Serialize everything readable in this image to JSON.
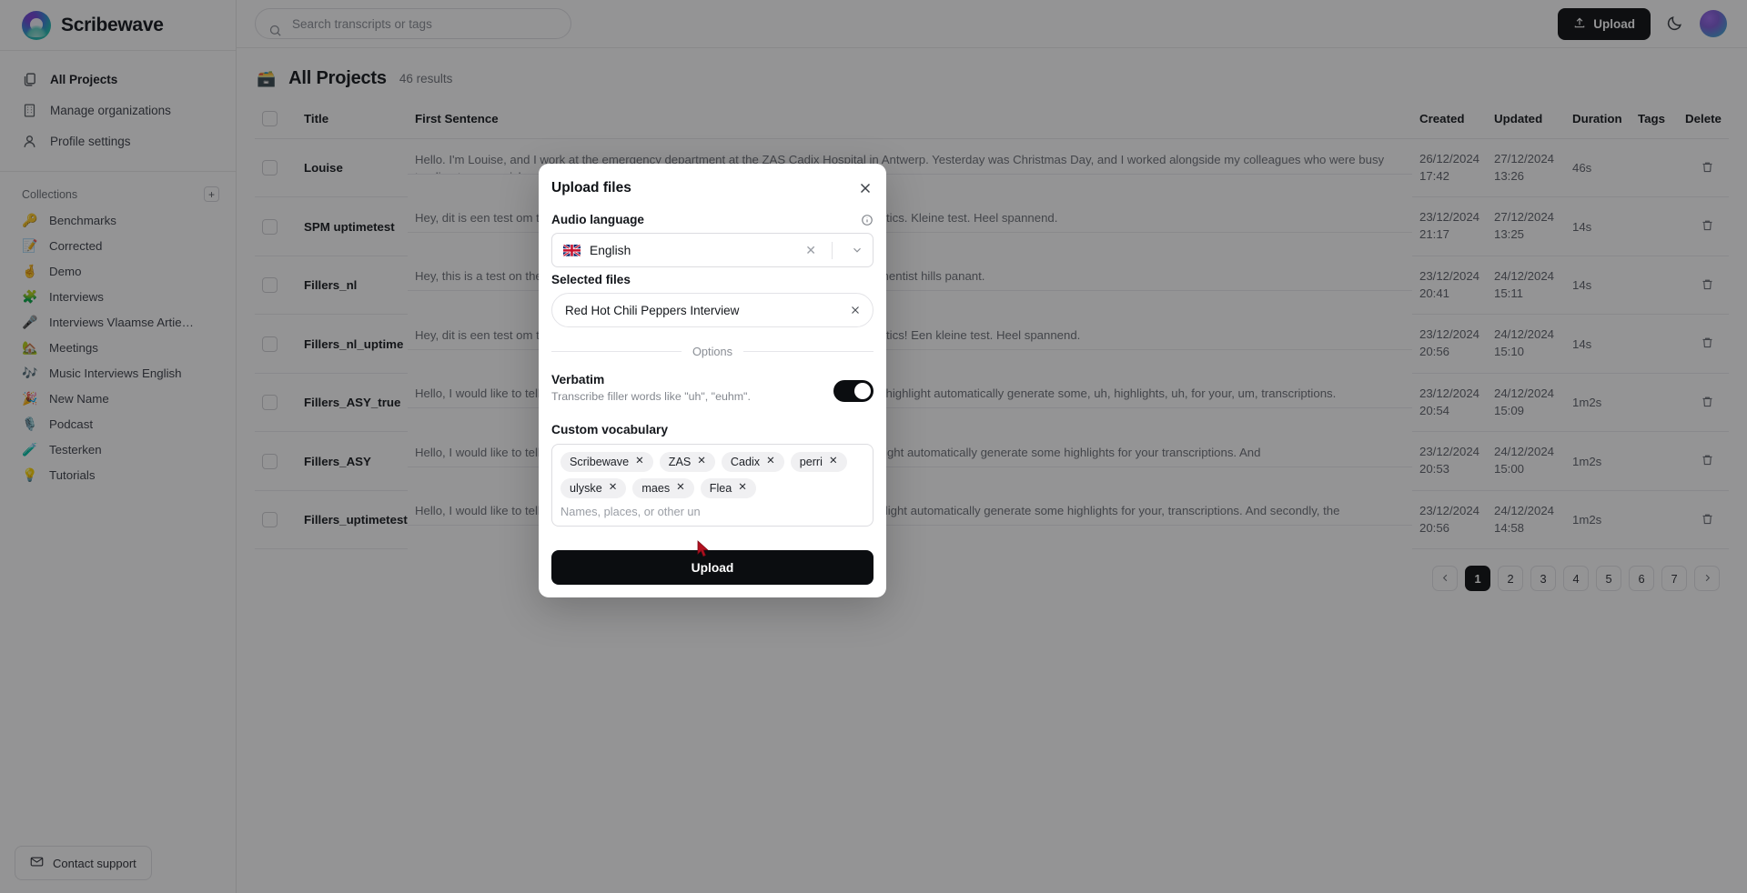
{
  "brand": {
    "name": "Scribewave",
    "logo_icon": "scribewave-logo"
  },
  "sidebar": {
    "nav": [
      {
        "label": "All Projects",
        "icon": "documents-icon"
      },
      {
        "label": "Manage organizations",
        "icon": "building-icon"
      },
      {
        "label": "Profile settings",
        "icon": "user-icon"
      }
    ],
    "collections_title": "Collections",
    "add_icon": "plus-icon",
    "collections": [
      {
        "emoji": "🔑",
        "label": "Benchmarks"
      },
      {
        "emoji": "📝",
        "label": "Corrected"
      },
      {
        "emoji": "🤞",
        "label": "Demo"
      },
      {
        "emoji": "🧩",
        "label": "Interviews"
      },
      {
        "emoji": "🎤",
        "label": "Interviews Vlaamse Artiesten"
      },
      {
        "emoji": "🏡",
        "label": "Meetings"
      },
      {
        "emoji": "🎶",
        "label": "Music Interviews English"
      },
      {
        "emoji": "🎉",
        "label": "New Name"
      },
      {
        "emoji": "🎙️",
        "label": "Podcast"
      },
      {
        "emoji": "🧪",
        "label": "Testerken"
      },
      {
        "emoji": "💡",
        "label": "Tutorials"
      }
    ],
    "support_label": "Contact support",
    "support_icon": "mail-icon"
  },
  "topbar": {
    "search_placeholder": "Search transcripts or tags",
    "search_value": "",
    "search_icon": "search-icon",
    "upload_label": "Upload",
    "upload_icon": "upload-icon",
    "theme_icon": "moon-icon",
    "avatar_icon": "avatar"
  },
  "page": {
    "emoji": "🗃️",
    "title": "All Projects",
    "results": "46 results"
  },
  "table": {
    "headers": [
      "Title",
      "First Sentence",
      "Created",
      "Updated",
      "Duration",
      "Tags",
      "Delete"
    ],
    "rows": [
      {
        "title": "Louise",
        "sentence": "Hello. I'm Louise, and I work at the emergency department at the ZAS Cadix Hospital in Antwerp. Yesterday was Christmas Day, and I worked alongside my colleagues who were busy tending to many sick patients. It was hectic, so we arranged a little walking",
        "created": "26/12/2024 17:42",
        "updated": "27/12/2024 13:26",
        "duration": "46s"
      },
      {
        "title": "SPM uptimetest",
        "sentence": "Hey, dit is een test om te kijken of alles nog steeds goed gefilterd worden met Speechmatics. Kleine test. Heel spannend.",
        "created": "23/12/2024 21:17",
        "updated": "27/12/2024 13:25",
        "duration": "14s"
      },
      {
        "title": "Fillers_nl",
        "sentence": "Hey, this is a test on the get some fillers in there to see what were the speechmatics clementist hills panant.",
        "created": "23/12/2024 20:41",
        "updated": "24/12/2024 15:11",
        "duration": "14s"
      },
      {
        "title": "Fillers_nl_uptime",
        "sentence": "Hey, dit is een test om te kijken of alles nog steeds goed gefilterd worden met Speechmatics! Een kleine test. Heel spannend.",
        "created": "23/12/2024 20:56",
        "updated": "24/12/2024 15:10",
        "duration": "14s"
      },
      {
        "title": "Fillers_ASY_true",
        "sentence": "Hello, I would like to tell you about Scribewave, um, a very nice, tool which allows you to highlight automatically generate some, uh, highlights, uh, for your, um, transcriptions.",
        "created": "23/12/2024 20:54",
        "updated": "24/12/2024 15:09",
        "duration": "1m2s"
      },
      {
        "title": "Fillers_ASY",
        "sentence": "Hello, I would like to tell you about Scribewave, a very nice tool which allows you to highlight automatically generate some highlights for your transcriptions. And",
        "created": "23/12/2024 20:53",
        "updated": "24/12/2024 15:00",
        "duration": "1m2s"
      },
      {
        "title": "Fillers_uptimetest",
        "sentence": "Hello, I would like to tell you about Scribewave, a very nice, tool which allows you to highlight automatically generate some highlights for your, transcriptions. And secondly, the",
        "created": "23/12/2024 20:56",
        "updated": "24/12/2024 14:58",
        "duration": "1m2s"
      }
    ]
  },
  "pagination": {
    "prev_icon": "chevron-left-icon",
    "next_icon": "chevron-right-icon",
    "pages": [
      "1",
      "2",
      "3",
      "4",
      "5",
      "6",
      "7"
    ],
    "active": "1"
  },
  "modal": {
    "title": "Upload files",
    "close_icon": "close-icon",
    "audio_language_label": "Audio language",
    "info_icon": "info-icon",
    "language_value": "English",
    "language_flag": "uk-flag",
    "language_clear_icon": "clear-icon",
    "language_caret_icon": "chevron-down-icon",
    "selected_files_label": "Selected files",
    "selected_file": "Red Hot Chili Peppers Interview",
    "file_remove_icon": "close-icon",
    "options_divider_label": "Options",
    "verbatim_title": "Verbatim",
    "verbatim_subtitle": "Transcribe filler words like \"uh\", \"euhm\".",
    "verbatim_on": true,
    "custom_vocabulary_label": "Custom vocabulary",
    "vocabulary_tags": [
      "Scribewave",
      "ZAS",
      "Cadix",
      "perri",
      "ulyske",
      "maes",
      "Flea"
    ],
    "vocabulary_placeholder": "Names, places, or other un",
    "vocabulary_input_value": "",
    "submit_label": "Upload"
  },
  "colors": {
    "accent": "#0b0d10",
    "muted_text": "#6c7077",
    "border": "#e6e6ea",
    "tag_bg": "#f0f0f2"
  }
}
